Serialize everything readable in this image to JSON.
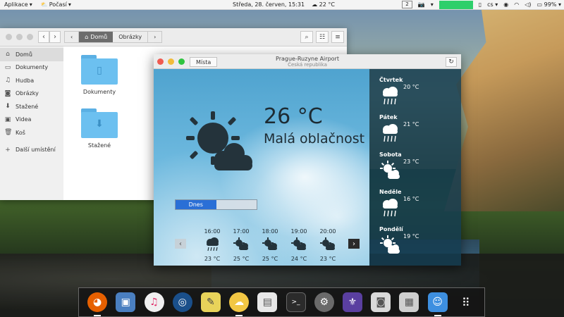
{
  "topbar": {
    "apps_menu": "Aplikace",
    "weather_app_menu": "Počasí",
    "clock": "Středa, 28. červen, 15:31",
    "weather_temp": "22 °C",
    "workspace": "2",
    "keyboard_layout": "cs",
    "battery": "99%"
  },
  "files": {
    "breadcrumb": {
      "home": "Domů",
      "current": "Obrázky"
    },
    "sidebar": [
      {
        "label": "Domů",
        "icon": "home-icon",
        "active": true
      },
      {
        "label": "Dokumenty",
        "icon": "document-icon"
      },
      {
        "label": "Hudba",
        "icon": "music-icon"
      },
      {
        "label": "Obrázky",
        "icon": "camera-icon"
      },
      {
        "label": "Stažené",
        "icon": "download-icon"
      },
      {
        "label": "Videa",
        "icon": "video-icon"
      },
      {
        "label": "Koš",
        "icon": "trash-icon"
      }
    ],
    "other_places": "Další umístění",
    "folders": [
      {
        "name": "Dokumenty",
        "icon": "document-icon"
      },
      {
        "name": "Stažené",
        "icon": "download-icon"
      }
    ]
  },
  "weather": {
    "places_button": "Místa",
    "location": "Prague-Ruzyne Airport",
    "country": "Česká republika",
    "temperature": "26 °C",
    "condition": "Malá oblačnost",
    "tab_today": "Dnes",
    "tab_tomorrow": "",
    "hourly": [
      {
        "time": "16:00",
        "temp": "23 °C",
        "icon": "rain-icon"
      },
      {
        "time": "17:00",
        "temp": "25 °C",
        "icon": "partly-cloudy-icon"
      },
      {
        "time": "18:00",
        "temp": "25 °C",
        "icon": "partly-cloudy-icon"
      },
      {
        "time": "19:00",
        "temp": "24 °C",
        "icon": "partly-cloudy-icon"
      },
      {
        "time": "20:00",
        "temp": "23 °C",
        "icon": "partly-cloudy-icon"
      }
    ],
    "forecast": [
      {
        "day": "Čtvrtek",
        "temp": "20 °C",
        "icon": "rain-icon"
      },
      {
        "day": "Pátek",
        "temp": "21 °C",
        "icon": "rain-icon"
      },
      {
        "day": "Sobota",
        "temp": "23 °C",
        "icon": "partly-cloudy-icon"
      },
      {
        "day": "Neděle",
        "temp": "16 °C",
        "icon": "rain-icon"
      },
      {
        "day": "Pondělí",
        "temp": "19 °C",
        "icon": "partly-cloudy-icon"
      }
    ]
  },
  "dock": [
    {
      "name": "firefox-icon",
      "color": "#e66000"
    },
    {
      "name": "image-viewer-icon",
      "color": "#4a7fc0"
    },
    {
      "name": "music-icon",
      "color": "#f0f0f0"
    },
    {
      "name": "browser-icon",
      "color": "#1a4f8a"
    },
    {
      "name": "notes-icon",
      "color": "#e8d35a"
    },
    {
      "name": "weather-icon",
      "color": "#f2c744"
    },
    {
      "name": "text-editor-icon",
      "color": "#e8e8e8"
    },
    {
      "name": "terminal-icon",
      "color": "#2b2b2b"
    },
    {
      "name": "settings-icon",
      "color": "#6a6a6a"
    },
    {
      "name": "software-icon",
      "color": "#5a3fa0"
    },
    {
      "name": "screenshot-icon",
      "color": "#d9d9d9"
    },
    {
      "name": "calendar-icon",
      "color": "#cfcfcf"
    },
    {
      "name": "finder-icon",
      "color": "#3d8fe0"
    },
    {
      "name": "app-grid-icon",
      "color": "#2b2b2b"
    }
  ]
}
